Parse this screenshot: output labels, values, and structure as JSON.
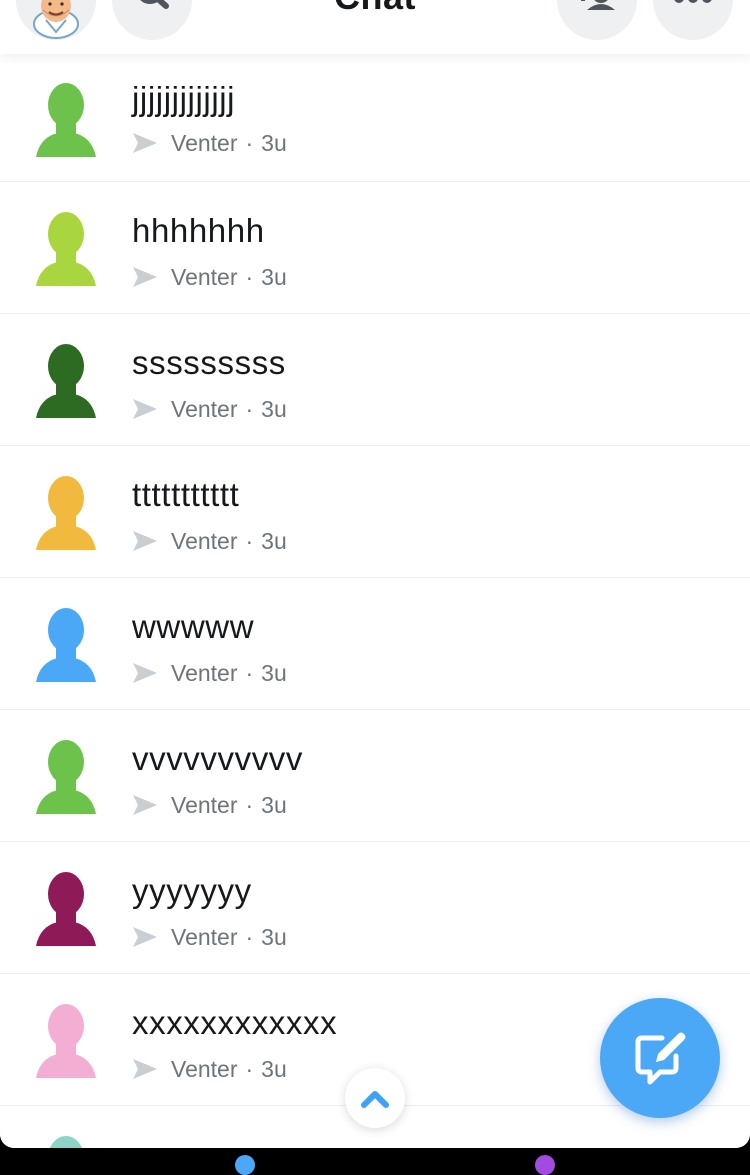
{
  "header": {
    "title": "Chat",
    "icons": {
      "avatar": "bitmoji-avatar-icon",
      "search": "search-icon",
      "add_friend": "add-friend-icon",
      "more": "more-icon"
    }
  },
  "chats": [
    {
      "name": "jjjjjjjjjjjjj",
      "status": "Venter",
      "time": "3u",
      "avatar_color": "#6cc24a"
    },
    {
      "name": "hhhhhhh",
      "status": "Venter",
      "time": "3u",
      "avatar_color": "#a9d63f"
    },
    {
      "name": "sssssssss",
      "status": "Venter",
      "time": "3u",
      "avatar_color": "#2e6b22"
    },
    {
      "name": "ttttttttttt",
      "status": "Venter",
      "time": "3u",
      "avatar_color": "#f2b93f"
    },
    {
      "name": "wwwww",
      "status": "Venter",
      "time": "3u",
      "avatar_color": "#4aa8f7"
    },
    {
      "name": "vvvvvvvvvv",
      "status": "Venter",
      "time": "3u",
      "avatar_color": "#6cc24a"
    },
    {
      "name": "yyyyyyy",
      "status": "Venter",
      "time": "3u",
      "avatar_color": "#8e1b57"
    },
    {
      "name": "xxxxxxxxxxxx",
      "status": "Venter",
      "time": "3u",
      "avatar_color": "#f2aed3"
    }
  ],
  "partial_chat": {
    "avatar_color": "#8fd3c6"
  },
  "separator": "·",
  "colors": {
    "accent": "#4aa8f7",
    "sent_arrow": "#c9ced3",
    "nav_dot_left": "#4aa8f7",
    "nav_dot_right": "#a14be0"
  },
  "fab_icon": "new-chat-icon",
  "scroll_icon": "chevron-up-icon"
}
